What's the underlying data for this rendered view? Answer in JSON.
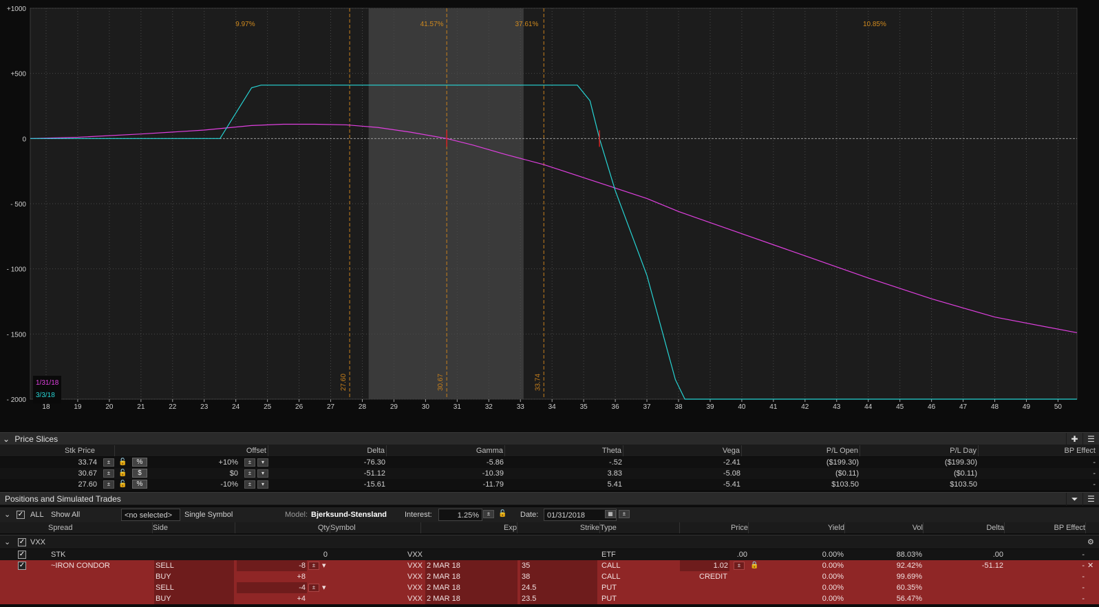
{
  "chart": {
    "y_ticks": [
      "+1000",
      "+500",
      "0",
      "- 500",
      "- 1000",
      "- 1500",
      "- 2000"
    ],
    "y_values": [
      1000,
      500,
      0,
      -500,
      -1000,
      -1500,
      -2000
    ],
    "x_ticks": [
      "18",
      "19",
      "20",
      "21",
      "22",
      "23",
      "24",
      "25",
      "26",
      "27",
      "28",
      "29",
      "30",
      "31",
      "32",
      "33",
      "34",
      "35",
      "36",
      "37",
      "38",
      "39",
      "40",
      "41",
      "42",
      "43",
      "44",
      "45",
      "46",
      "47",
      "48",
      "49",
      "50"
    ],
    "pct_labels": [
      {
        "text": "9.97%",
        "x": 24.3
      },
      {
        "text": "41.57%",
        "x": 30.2
      },
      {
        "text": "37.61%",
        "x": 33.2
      },
      {
        "text": "10.85%",
        "x": 44.2
      }
    ],
    "price_lines": [
      {
        "label": "27.60",
        "x": 27.6
      },
      {
        "label": "30.67",
        "x": 30.67
      },
      {
        "label": "33.74",
        "x": 33.74
      }
    ],
    "legend": [
      {
        "label": "1/31/18",
        "color": "#e040e0"
      },
      {
        "label": "3/3/18",
        "color": "#27d5d5"
      }
    ],
    "colors": {
      "today": "#e040e0",
      "expiry": "#27d5d5",
      "price_line": "#c8801c",
      "band": "#3a3a3a"
    }
  },
  "chart_data": {
    "type": "line",
    "xlim": [
      17.5,
      50.6
    ],
    "ylim": [
      -2000,
      1000
    ],
    "series": [
      {
        "name": "1/31/18",
        "x": [
          17.5,
          19,
          21,
          23,
          24.5,
          25.5,
          26.5,
          27.5,
          28.5,
          29.5,
          30.67,
          31.5,
          32.5,
          33.74,
          35,
          36,
          37,
          38,
          40,
          42,
          44,
          46,
          48,
          50.6
        ],
        "values": [
          0,
          10,
          35,
          65,
          100,
          110,
          110,
          105,
          85,
          50,
          0,
          -50,
          -120,
          -200,
          -300,
          -380,
          -460,
          -560,
          -730,
          -900,
          -1070,
          -1230,
          -1370,
          -1490
        ]
      },
      {
        "name": "3/3/18",
        "x": [
          17.5,
          23.5,
          24.5,
          24.8,
          34.8,
          35.2,
          35.5,
          36,
          37,
          37.9,
          38.2,
          50.6
        ],
        "values": [
          0,
          0,
          390,
          410,
          410,
          290,
          0,
          -400,
          -1050,
          -1850,
          -2000,
          -2000
        ]
      }
    ]
  },
  "price_slices": {
    "title": "Price Slices",
    "headers": [
      "Stk Price",
      "Offset",
      "Delta",
      "Gamma",
      "Theta",
      "Vega",
      "P/L Open",
      "P/L Day",
      "BP Effect"
    ],
    "rows": [
      {
        "stk": "33.74",
        "mode": "%",
        "offset": "+10%",
        "delta": "-76.30",
        "gamma": "-5.86",
        "theta": "-.52",
        "vega": "-2.41",
        "plopen": "($199.30)",
        "plday": "($199.30)",
        "bp": "-"
      },
      {
        "stk": "30.67",
        "mode": "$",
        "offset": "$0",
        "delta": "-51.12",
        "gamma": "-10.39",
        "theta": "3.83",
        "vega": "-5.08",
        "plopen": "($0.11)",
        "plday": "($0.11)",
        "bp": "-"
      },
      {
        "stk": "27.60",
        "mode": "%",
        "offset": "-10%",
        "delta": "-15.61",
        "gamma": "-11.79",
        "theta": "5.41",
        "vega": "-5.41",
        "plopen": "$103.50",
        "plday": "$103.50",
        "bp": "-"
      }
    ]
  },
  "positions": {
    "title": "Positions and Simulated Trades",
    "toolbar": {
      "all": "ALL",
      "show": "Show All",
      "selected": "<no selected>",
      "symbol_mode": "Single Symbol",
      "model_label": "Model:",
      "model": "Bjerksund-Stensland",
      "interest_label": "Interest:",
      "interest": "1.25%",
      "date_label": "Date:",
      "date": "01/31/2018"
    },
    "headers": [
      "Spread",
      "Side",
      "Qty",
      "Symbol",
      "Exp",
      "Strike",
      "Type",
      "Price",
      "Yield",
      "Vol",
      "Delta",
      "BP Effect"
    ],
    "group": "VXX",
    "stk_row": {
      "spread": "STK",
      "qty": "0",
      "symbol": "VXX",
      "type": "ETF",
      "price": ".00",
      "yield": "0.00%",
      "vol": "88.03%",
      "delta": ".00",
      "bp": "-"
    },
    "legs": [
      {
        "spread": "~IRON CONDOR",
        "side": "SELL",
        "qty": "-8",
        "symbol": "VXX",
        "exp": "2 MAR 18",
        "strike": "35",
        "type": "CALL",
        "price": "1.02",
        "yield": "0.00%",
        "vol": "92.42%",
        "delta": "-51.12",
        "bp": "-"
      },
      {
        "spread": "",
        "side": "BUY",
        "qty": "+8",
        "symbol": "VXX",
        "exp": "2 MAR 18",
        "strike": "38",
        "type": "CALL",
        "price": "CREDIT",
        "yield": "0.00%",
        "vol": "99.69%",
        "delta": "",
        "bp": "-"
      },
      {
        "spread": "",
        "side": "SELL",
        "qty": "-4",
        "symbol": "VXX",
        "exp": "2 MAR 18",
        "strike": "24.5",
        "type": "PUT",
        "price": "",
        "yield": "0.00%",
        "vol": "60.35%",
        "delta": "",
        "bp": "-"
      },
      {
        "spread": "",
        "side": "BUY",
        "qty": "+4",
        "symbol": "VXX",
        "exp": "2 MAR 18",
        "strike": "23.5",
        "type": "PUT",
        "price": "",
        "yield": "0.00%",
        "vol": "56.47%",
        "delta": "",
        "bp": "-"
      }
    ]
  }
}
